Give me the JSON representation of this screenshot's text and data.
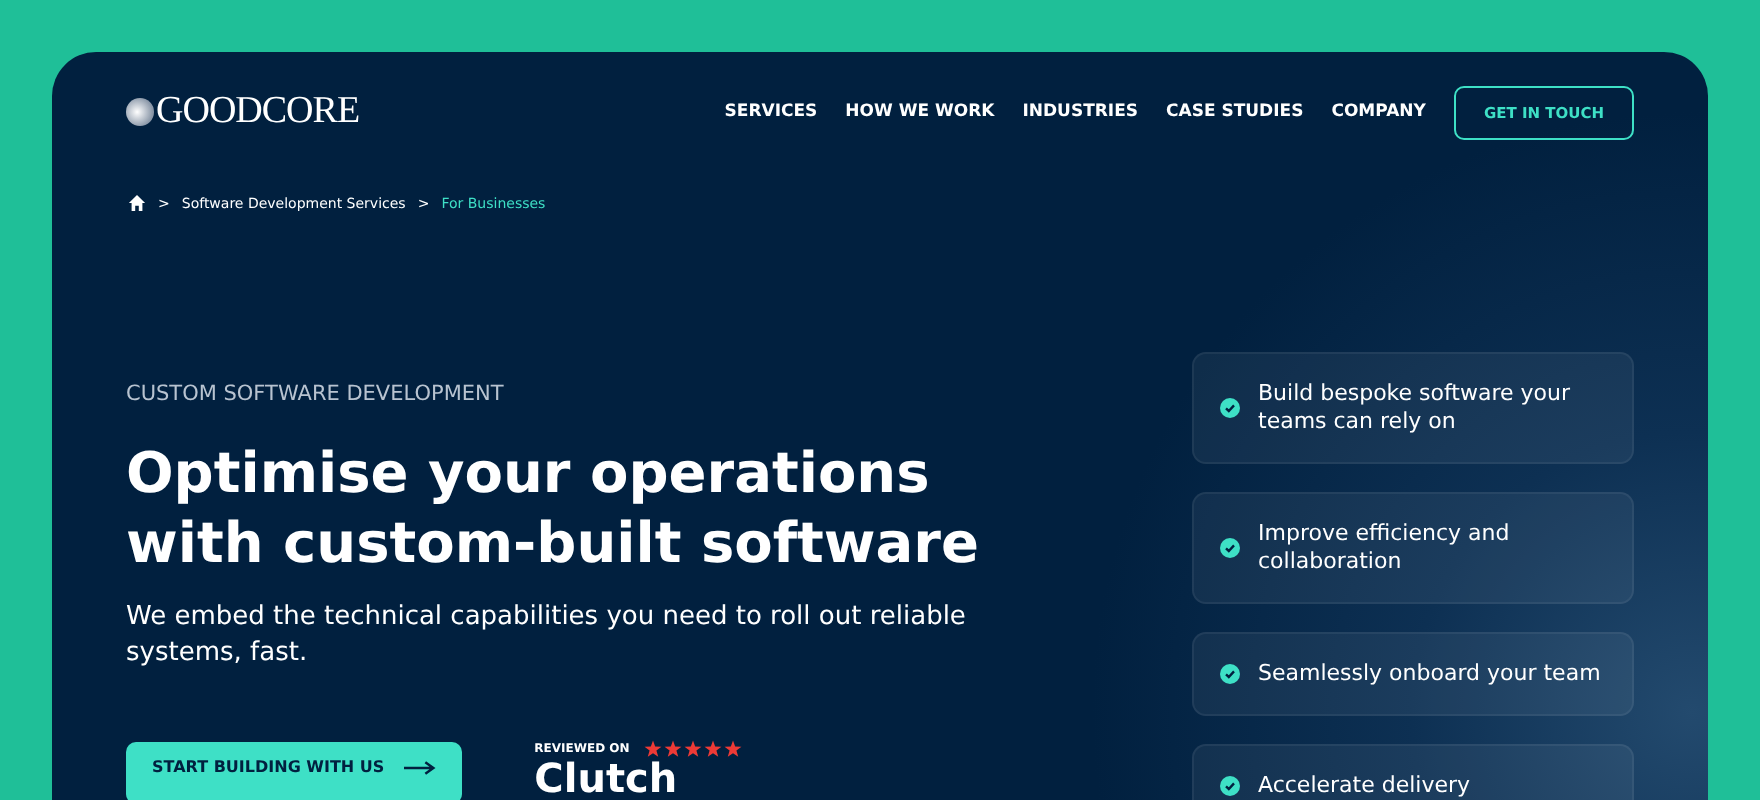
{
  "logo": {
    "text": "GOODCORE"
  },
  "nav": {
    "items": [
      "SERVICES",
      "HOW WE WORK",
      "INDUSTRIES",
      "CASE STUDIES",
      "COMPANY"
    ],
    "cta": "GET IN TOUCH"
  },
  "breadcrumb": [
    {
      "label": "Software Development Services",
      "current": false
    },
    {
      "label": "For Businesses",
      "current": true
    }
  ],
  "separator": ">",
  "hero": {
    "eyebrow": "CUSTOM SOFTWARE DEVELOPMENT",
    "title_lines": [
      "Optimise your operations",
      "with custom-built software"
    ],
    "subtitle": "We embed the technical capabilities you need to roll out reliable systems, fast.",
    "button": "START BUILDING WITH US"
  },
  "review": {
    "label": "REVIEWED ON",
    "stars": 5,
    "brand": "Clutch"
  },
  "benefits": [
    "Build bespoke software your teams can rely on",
    "Improve efficiency and collaboration",
    "Seamlessly onboard your team",
    "Accelerate delivery"
  ]
}
